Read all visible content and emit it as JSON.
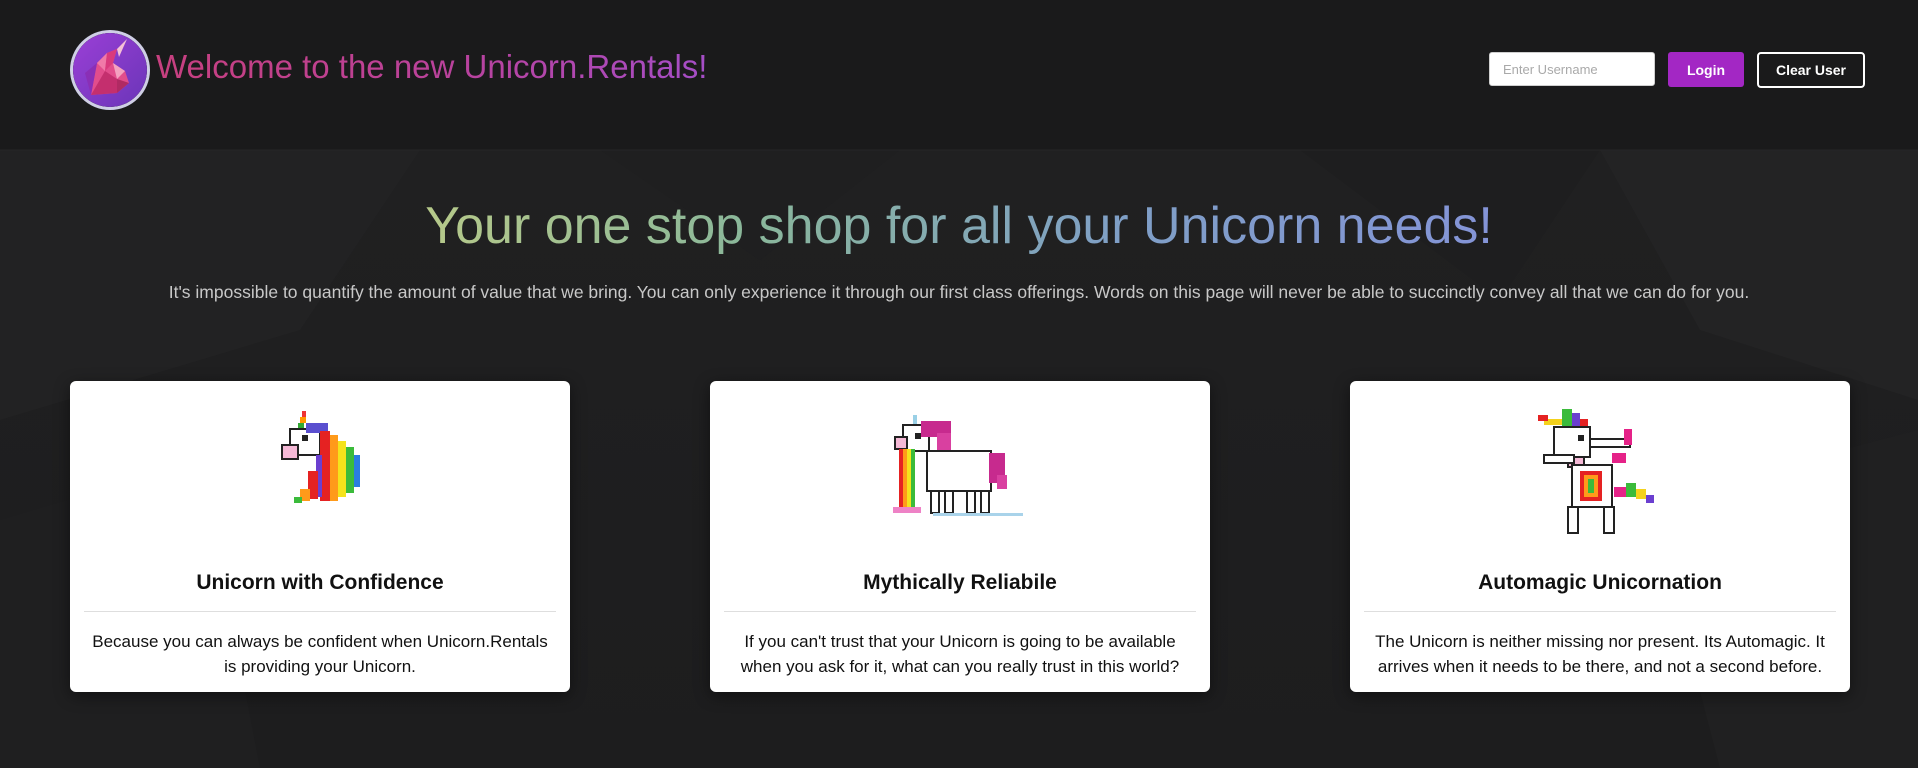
{
  "header": {
    "title": "Welcome to the new Unicorn.Rentals!",
    "username_placeholder": "Enter Username",
    "username_value": "",
    "login_label": "Login",
    "clear_label": "Clear User"
  },
  "hero": {
    "title": "Your one stop shop for all your Unicorn needs!",
    "subtitle": "It's impossible to quantify the amount of value that we bring. You can only experience it through our first class offerings. Words on this page will never be able to succinctly convey all that we can do for you."
  },
  "cards": [
    {
      "image": "rainbow-mane-unicorn-head",
      "title": "Unicorn with Confidence",
      "text": "Because you can always be confident when Unicorn.Rentals is providing your Unicorn."
    },
    {
      "image": "rainbow-sick-unicorn",
      "title": "Mythically Reliabile",
      "text": "If you can't trust that your Unicorn is going to be available when you ask for it, what can you really trust in this world?"
    },
    {
      "image": "dabbing-unicorn",
      "title": "Automagic Unicornation",
      "text": "The Unicorn is neither missing nor present. Its Automagic. It arrives when it needs to be there, and not a second before."
    }
  ],
  "colors": {
    "background": "#1b1b1c",
    "brand_title_start": "#c7407f",
    "brand_title_end": "#a54ec7",
    "login_button": "#a327c4",
    "hero_gradient_start": "#b6c98a",
    "hero_gradient_end": "#8494d7"
  }
}
